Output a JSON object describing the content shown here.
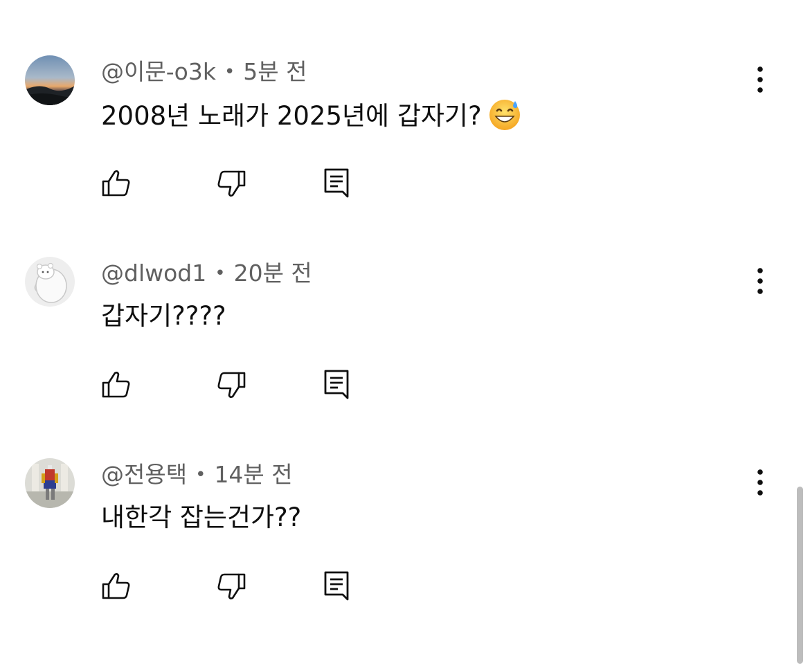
{
  "comments": [
    {
      "author": "@이문-o3k",
      "separator": "•",
      "time": "5분 전",
      "text": "2008년 노래가 2025년에 갑자기?",
      "emoji": "grinning-face-with-sweat-icon"
    },
    {
      "author": "@dlwod1",
      "separator": "•",
      "time": "20분 전",
      "text": "갑자기????"
    },
    {
      "author": "@전용택",
      "separator": "•",
      "time": "14분 전",
      "text": "내한각 잡는건가??"
    }
  ],
  "icons": {
    "like": "thumbs-up-icon",
    "dislike": "thumbs-down-icon",
    "reply": "reply-comment-icon",
    "menu": "more-vertical-icon"
  },
  "colors": {
    "text": "#0f0f0f",
    "meta": "#606060",
    "scrollbar": "#bdbdbd"
  }
}
